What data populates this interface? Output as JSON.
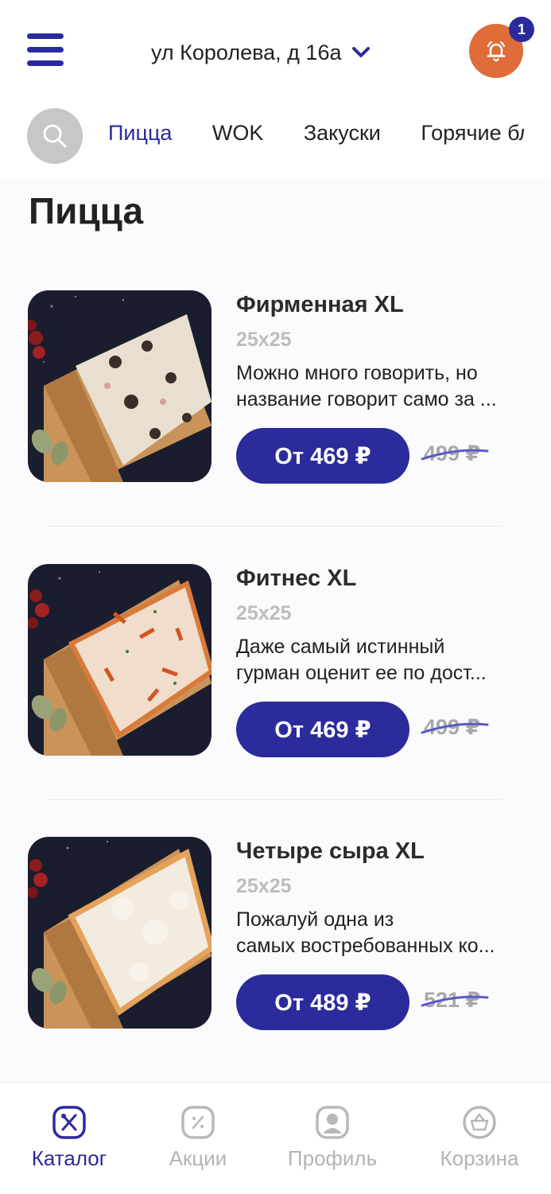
{
  "header": {
    "address": "ул Королева, д 16а",
    "notification_count": "1"
  },
  "categories": [
    "Пицца",
    "WOK",
    "Закуски",
    "Горячие блюда"
  ],
  "active_category": "Пицца",
  "section_title": "Пицца",
  "products": [
    {
      "name": "Фирменная XL",
      "size": "25x25",
      "description_line1": "Можно много говорить, но",
      "description_line2": "название говорит само за ...",
      "price": "От 469 ₽",
      "old_price": "499 ₽",
      "topping": "mushroom"
    },
    {
      "name": "Фитнес XL",
      "size": "25x25",
      "description_line1": "Даже самый истинный",
      "description_line2": "гурман оценит ее по дост...",
      "price": "От 469 ₽",
      "old_price": "499 ₽",
      "topping": "pepper"
    },
    {
      "name": "Четыре сыра XL",
      "size": "25x25",
      "description_line1": "Пожалуй одна из",
      "description_line2": "самых востребованных ко...",
      "price": "От 489 ₽",
      "old_price": "521 ₽",
      "topping": "cheese"
    }
  ],
  "bottom_nav": [
    {
      "label": "Каталог",
      "icon": "catalog-icon",
      "active": true
    },
    {
      "label": "Акции",
      "icon": "discount-icon",
      "active": false
    },
    {
      "label": "Профиль",
      "icon": "profile-icon",
      "active": false
    },
    {
      "label": "Корзина",
      "icon": "basket-icon",
      "active": false
    }
  ],
  "colors": {
    "accent": "#2a2aa0",
    "bell": "#e06c3a",
    "muted": "#b3b3b3"
  }
}
